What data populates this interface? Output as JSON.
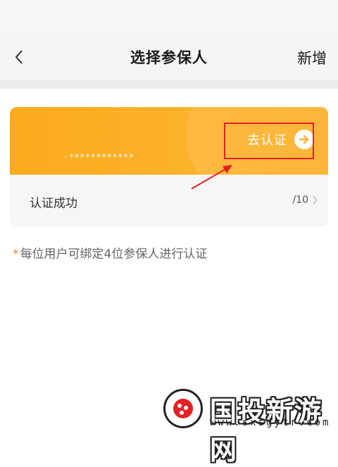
{
  "nav": {
    "title": "选择参保人",
    "action_label": "新增"
  },
  "card": {
    "masked_id": "·************",
    "verify_label": "去认证",
    "status_text": "认证成功",
    "count_text": "/10"
  },
  "note": {
    "prefix": "*",
    "text": "每位用户可绑定4位参保人进行认证"
  },
  "watermark": {
    "brand": "国投新游网",
    "url": "www.sxsgytr.com"
  },
  "colors": {
    "card_orange": "#fdb22c",
    "highlight_red": "#e32222",
    "note_star": "#f08a24"
  },
  "icons": {
    "back": "chevron-left-icon",
    "verify_arrow": "arrow-right-circle-icon",
    "row_chevron": "chevron-right-icon"
  }
}
